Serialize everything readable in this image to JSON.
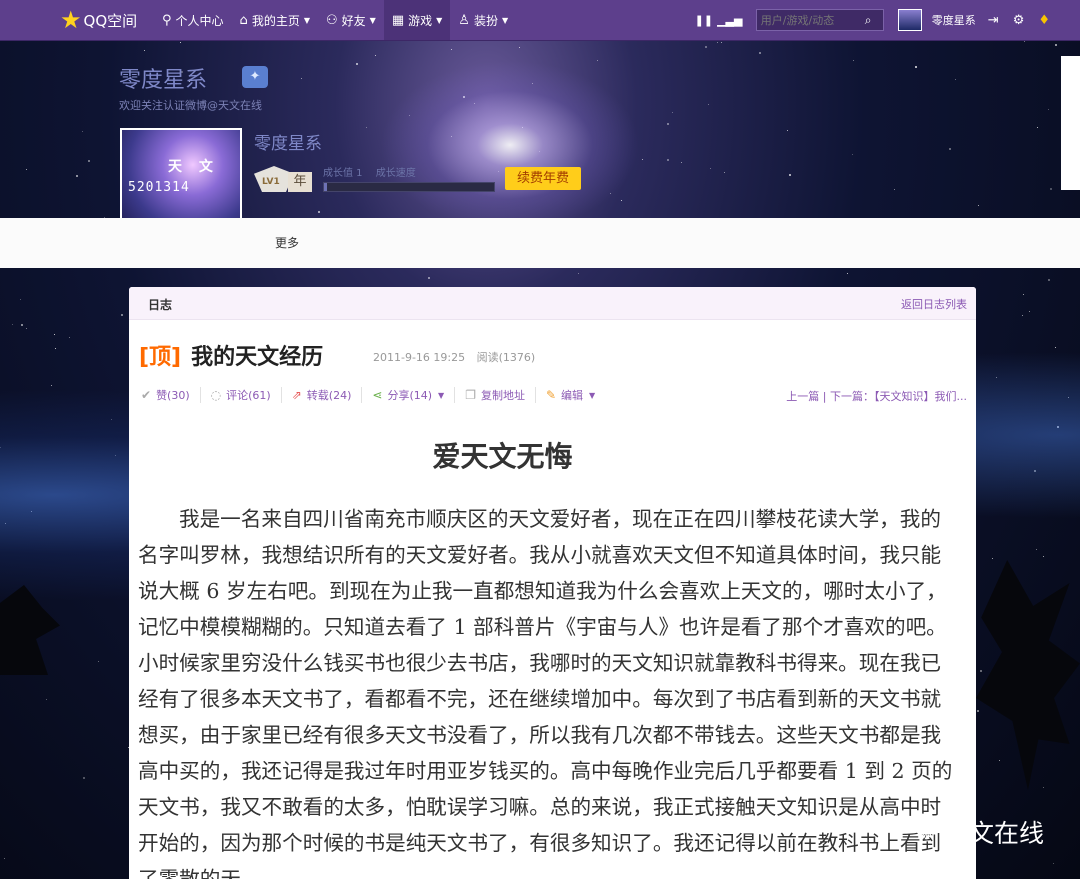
{
  "topbar": {
    "logo": "QQ空间",
    "nav": [
      {
        "label": "个人中心",
        "icon": "person-icon",
        "caret": false
      },
      {
        "label": "我的主页",
        "icon": "home-icon",
        "caret": true
      },
      {
        "label": "好友",
        "icon": "friends-icon",
        "caret": true
      },
      {
        "label": "游戏",
        "icon": "grid-icon",
        "caret": true
      },
      {
        "label": "装扮",
        "icon": "shirt-icon",
        "caret": true
      }
    ],
    "search_placeholder": "用户/游戏/动态",
    "username": "零度星系"
  },
  "header": {
    "space_title": "零度星系",
    "subtitle": "欢迎关注认证微博@天文在线",
    "avatar_text_1": "天 文",
    "avatar_text_2": "5201314",
    "nickname": "零度星系",
    "level": "LV1",
    "year": "年",
    "growth_label": "成长值 1",
    "speed_label": "成长速度",
    "growth_progress": 0.02,
    "renew": "续费年费",
    "more": "更多"
  },
  "blog": {
    "section": "日志",
    "back_link": "返回日志列表",
    "pin": "[顶]",
    "title": "我的天文经历",
    "date": "2011-9-16 19:25",
    "reads": "阅读(1376)",
    "actions": [
      {
        "label": "赞(30)",
        "icon": "check-icon"
      },
      {
        "label": "评论(61)",
        "icon": "comment-icon"
      },
      {
        "label": "转载(24)",
        "icon": "repost-icon"
      },
      {
        "label": "分享(14)",
        "icon": "share-icon"
      },
      {
        "label": "复制地址",
        "icon": "copy-icon"
      },
      {
        "label": "编辑",
        "icon": "edit-icon"
      }
    ],
    "pager": "上一篇 | 下一篇：【天文知识】我们...",
    "article_title": "爱天文无悔",
    "article_body": "我是一名来自四川省南充市顺庆区的天文爱好者，现在正在四川攀枝花读大学，我的名字叫罗林，我想结识所有的天文爱好者。我从小就喜欢天文但不知道具体时间，我只能说大概 6 岁左右吧。到现在为止我一直都想知道我为什么会喜欢上天文的，哪时太小了，记忆中模模糊糊的。只知道去看了 1 部科普片《宇宙与人》也许是看了那个才喜欢的吧。小时候家里穷没什么钱买书也很少去书店，我哪时的天文知识就靠教科书得来。现在我已经有了很多本天文书了，看都看不完，还在继续增加中。每次到了书店看到新的天文书就想买，由于家里已经有很多天文书没看了，所以我有几次都不带钱去。这些天文书都是我高中买的，我还记得是我过年时用亚岁钱买的。高中每晚作业完后几乎都要看 1 到 2 页的天文书，我又不敢看的太多，怕耽误学习嘛。总的来说，我正式接触天文知识是从高中时开始的，因为那个时候的书是纯天文书了，有很多知识了。我还记得以前在教科书上看到了零散的天"
  },
  "watermark": "天文在线"
}
